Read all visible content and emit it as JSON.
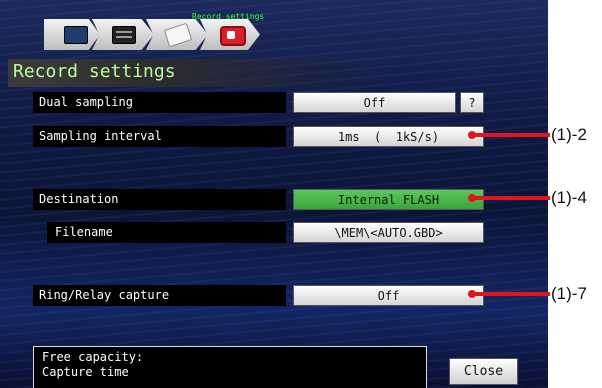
{
  "breadcrumb": {
    "current": "Record settings",
    "steps": [
      {
        "icon": "monitor-icon"
      },
      {
        "icon": "module-icon"
      },
      {
        "icon": "document-icon"
      },
      {
        "icon": "record-icon"
      }
    ]
  },
  "page_title": "Record settings",
  "rows": {
    "dual_sampling": {
      "label": "Dual sampling",
      "value": "Off",
      "help": "?"
    },
    "sampling_interval": {
      "label": "Sampling interval",
      "value": "1ms  (  1kS/s)"
    },
    "destination": {
      "label": "Destination",
      "value": "Internal FLASH"
    },
    "filename": {
      "label": "Filename",
      "value": "\\MEM\\<AUTO.GBD>"
    },
    "ring_relay": {
      "label": "Ring/Relay capture",
      "value": "Off"
    }
  },
  "info_panel": {
    "line1": "Free capacity:",
    "line2": "Capture time"
  },
  "close_label": "Close",
  "callouts": {
    "c1": "(1)-2",
    "c2": "(1)-4",
    "c3": "(1)-7"
  },
  "colors": {
    "accent_green": "#3aa43a",
    "title_green": "#b9ff9b",
    "leader_red": "#e0151e"
  }
}
